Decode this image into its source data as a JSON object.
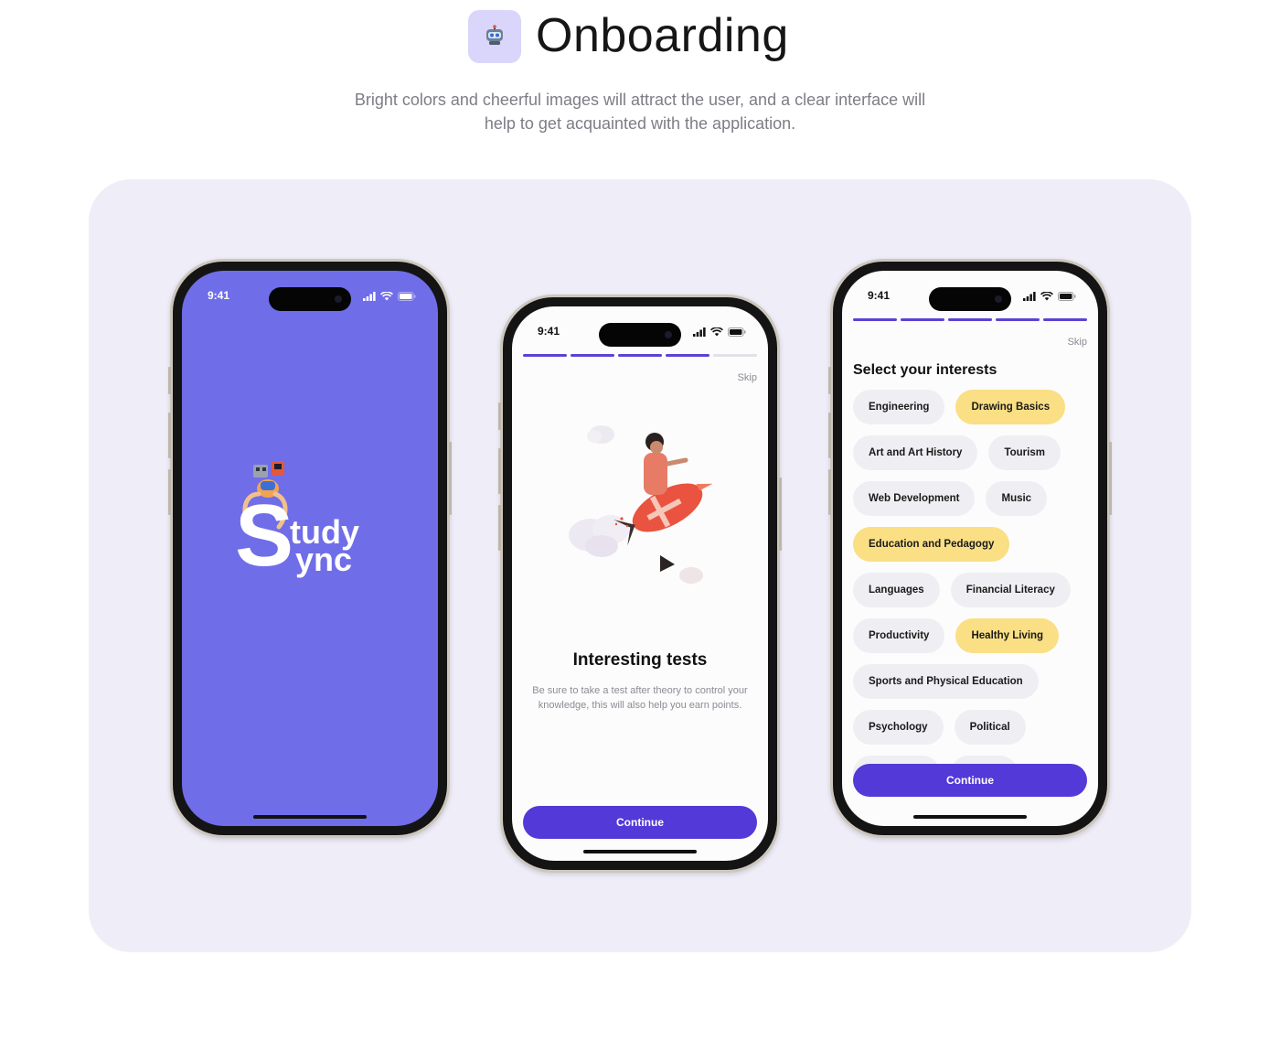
{
  "header": {
    "title": "Onboarding",
    "subtitle_line1": "Bright colors and cheerful images will attract the user, and a clear interface will",
    "subtitle_line2": "help to get acquainted with the application.",
    "icon": "robot-icon"
  },
  "status_bar": {
    "time": "9:41"
  },
  "splash": {
    "logo_letter": "S",
    "logo_line1": "tudy",
    "logo_line2": "ync"
  },
  "onboarding": {
    "progress_total": 5,
    "progress_done": 4,
    "skip": "Skip",
    "title": "Interesting tests",
    "body": "Be sure to take a test after theory to control your knowledge, this will also help you earn points.",
    "continue": "Continue"
  },
  "interests": {
    "progress_total": 5,
    "progress_done": 5,
    "skip": "Skip",
    "title": "Select your interests",
    "continue": "Continue",
    "rows": [
      [
        {
          "label": "Engineering",
          "selected": false
        },
        {
          "label": "Drawing Basics",
          "selected": true
        }
      ],
      [
        {
          "label": "Art and Art History",
          "selected": false
        },
        {
          "label": "Tourism",
          "selected": false
        }
      ],
      [
        {
          "label": "Web Development",
          "selected": false
        },
        {
          "label": "Music",
          "selected": false
        }
      ],
      [
        {
          "label": "Education and Pedagogy",
          "selected": true
        }
      ],
      [
        {
          "label": "Languages",
          "selected": false
        },
        {
          "label": "Financial Literacy",
          "selected": false
        }
      ],
      [
        {
          "label": "Productivity",
          "selected": false
        },
        {
          "label": "Healthy Living",
          "selected": true
        }
      ],
      [
        {
          "label": "Sports and Physical Education",
          "selected": false
        }
      ],
      [
        {
          "label": "Psychology",
          "selected": false
        },
        {
          "label": "Political",
          "selected": false
        }
      ],
      [
        {
          "label": "Astronomy",
          "selected": false
        },
        {
          "label": "History",
          "selected": false
        }
      ]
    ]
  },
  "colors": {
    "accent": "#5339d8",
    "splash_bg": "#6f6de8",
    "chip_selected": "#fadf84",
    "chip_default": "#efeff3",
    "stage_bg": "#efedf8"
  }
}
